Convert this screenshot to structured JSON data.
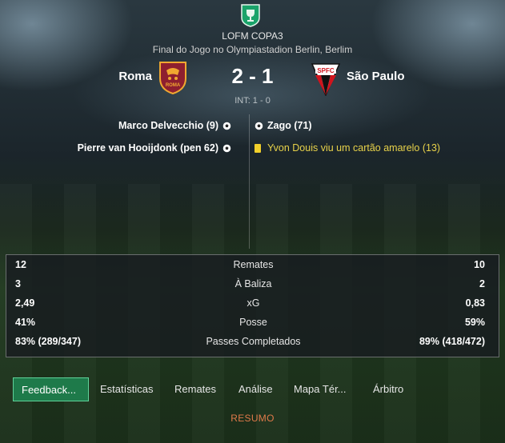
{
  "competition": {
    "name": "LOFM COPA3",
    "venue": "Final do Jogo no Olympiastadion Berlin, Berlim"
  },
  "match": {
    "home_team": "Roma",
    "away_team": "São Paulo",
    "score": "2 - 1",
    "interval": "INT: 1 - 0",
    "home_crest_text": "ROMA",
    "away_crest_text": "SPFC"
  },
  "events": {
    "home": [
      {
        "text": "Marco Delvecchio (9)",
        "icon": "ball-icon"
      },
      {
        "text": "Pierre van Hooijdonk (pen 62)",
        "icon": "ball-icon"
      }
    ],
    "away": [
      {
        "text": "Zago (71)",
        "icon": "ball-icon"
      },
      {
        "text": "Yvon Douis viu um cartão amarelo (13)",
        "icon": "yellow-card-icon"
      }
    ]
  },
  "stats": [
    {
      "label": "Remates",
      "home": "12",
      "away": "10"
    },
    {
      "label": "À Baliza",
      "home": "3",
      "away": "2"
    },
    {
      "label": "xG",
      "home": "2,49",
      "away": "0,83"
    },
    {
      "label": "Posse",
      "home": "41%",
      "away": "59%"
    },
    {
      "label": "Passes Completados",
      "home": "83% (289/347)",
      "away": "89% (418/472)"
    }
  ],
  "tabs": [
    "Feedback...",
    "Estatísticas",
    "Remates",
    "Análise",
    "Mapa Tér...",
    "Árbitro"
  ],
  "active_tab": "Feedback...",
  "footer_link": "RESUMO",
  "colors": {
    "accent_green": "#1e7a4a",
    "yellow_card": "#f2d02b",
    "link_orange": "#e07a4a",
    "roma_red": "#8e1f2f",
    "roma_gold": "#f0a830",
    "spfc_red": "#d0141d"
  }
}
